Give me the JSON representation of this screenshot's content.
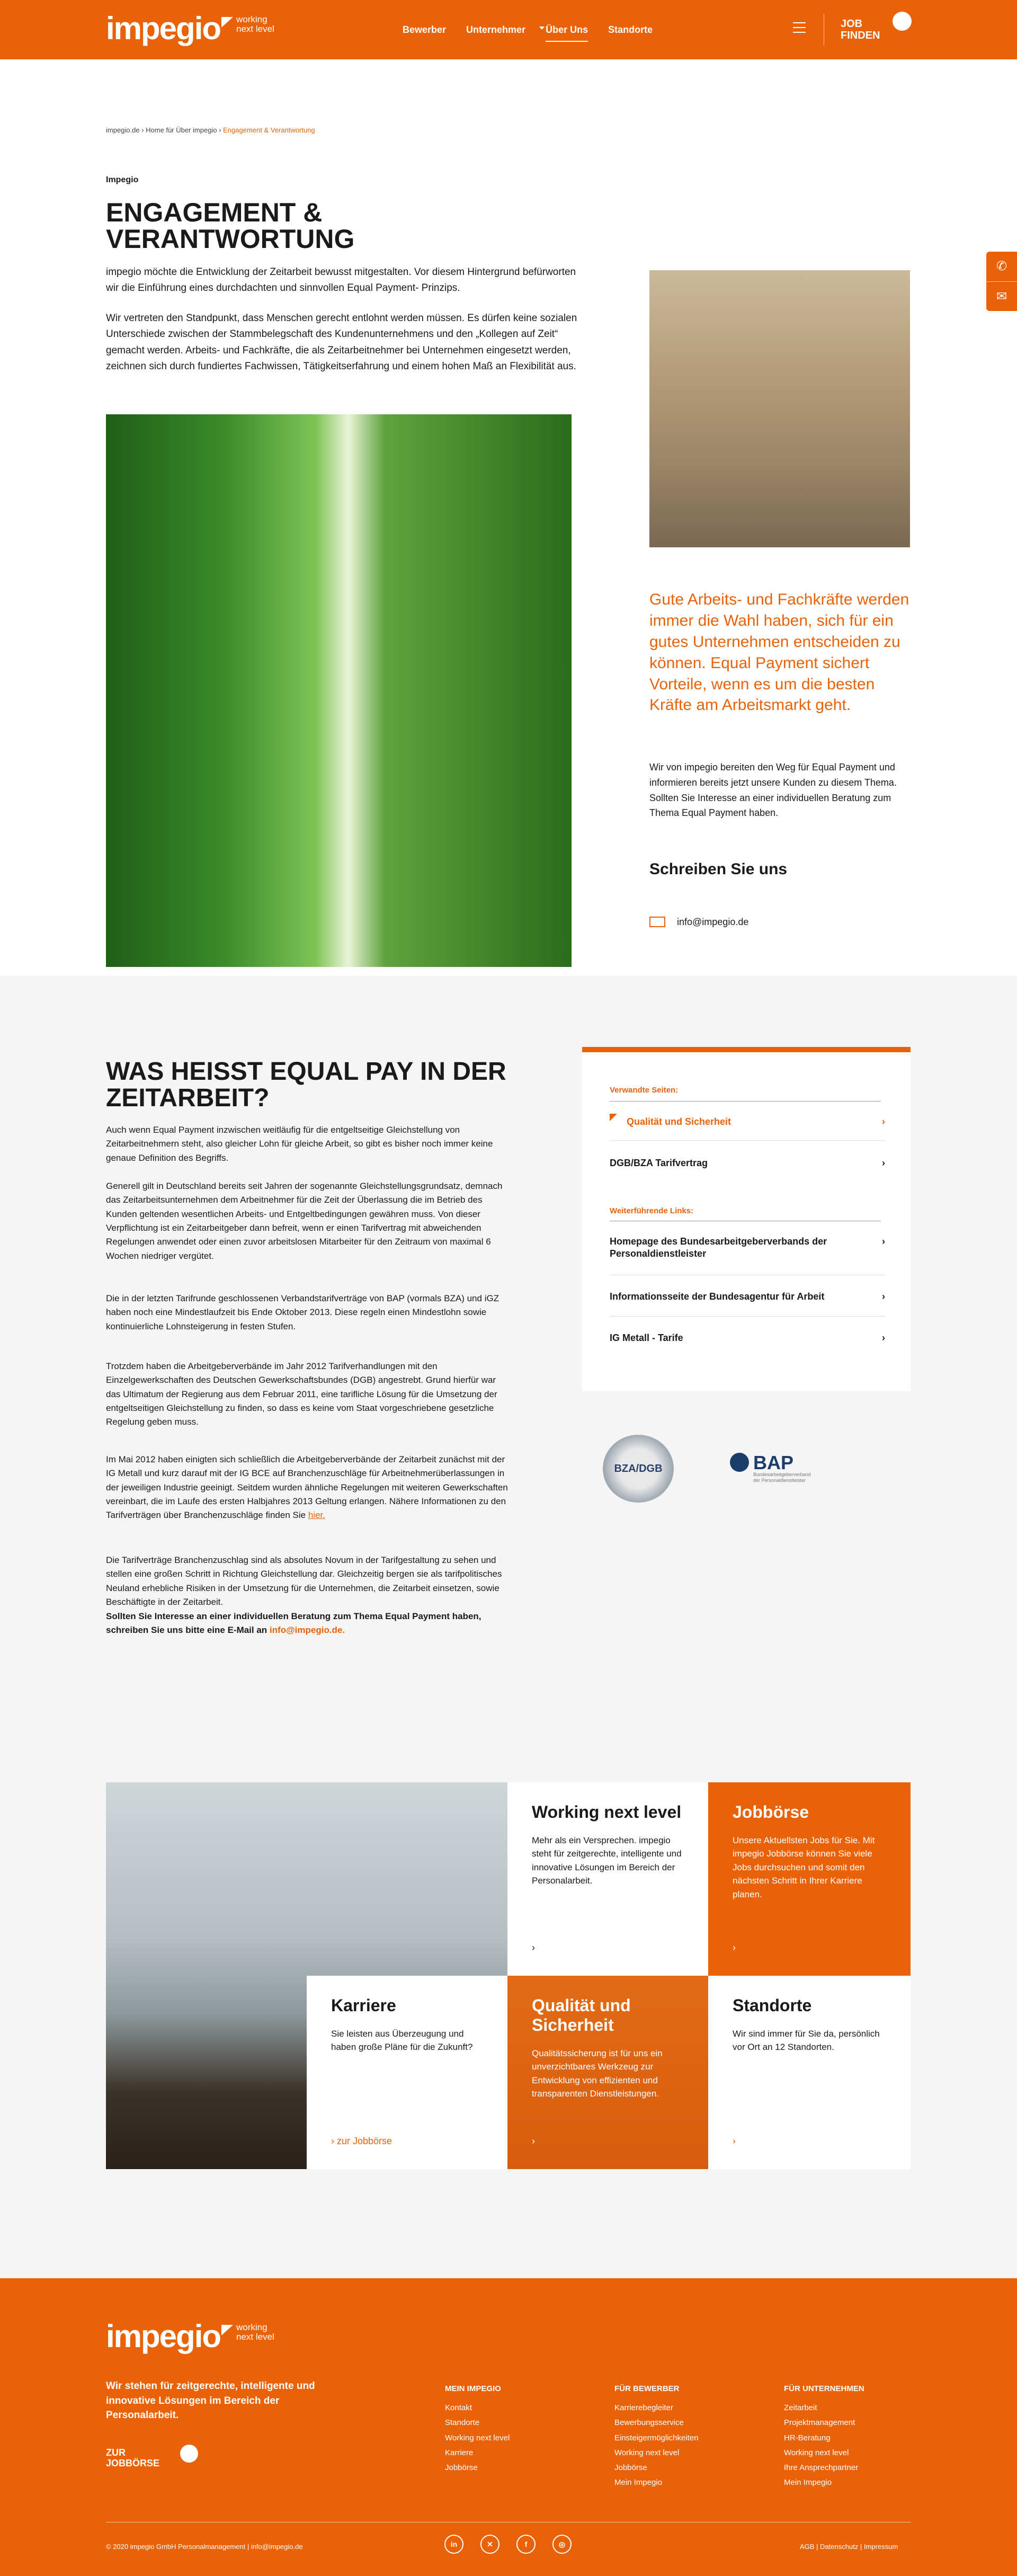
{
  "header": {
    "logo": "impegio",
    "tagline": [
      "working",
      "next level"
    ],
    "nav": [
      "Bewerber",
      "Unternehmer",
      "Über Uns",
      "Standorte"
    ],
    "job_finden": [
      "JOB",
      "FINDEN"
    ]
  },
  "breadcrumb": [
    "impegio.de",
    "Home für Über impegio",
    "Engagement & Verantwortung"
  ],
  "intro": {
    "label": "Impegio",
    "title": "ENGAGEMENT & VERANTWORTUNG",
    "p1": "impegio möchte die Entwicklung der Zeitarbeit bewusst mitgestalten. Vor diesem Hintergrund befürworten wir die Einführung eines durchdachten und sinnvollen Equal Payment- Prinzips.",
    "p2": "Wir vertreten den Standpunkt, dass Menschen gerecht entlohnt werden müssen. Es dürfen keine sozialen Unterschiede zwischen der Stammbelegschaft des Kundenunternehmens und den „Kollegen auf Zeit“ gemacht werden. Arbeits- und Fachkräfte, die als Zeitarbeitnehmer bei Unternehmen eingesetzt werden, zeichnen sich durch fundiertes Fachwissen, Tätigkeitserfahrung und einem hohen Maß an Flexibilität aus.",
    "quote": "Gute Arbeits- und Fachkräfte werden immer die Wahl haben, sich für ein gutes Unternehmen entscheiden zu können. Equal Payment sichert Vorteile, wenn es um die besten Kräfte am Arbeitsmarkt geht.",
    "qp": "Wir von impegio bereiten den Weg für Equal Payment und informieren bereits jetzt unsere Kunden zu diesem Thema. Sollten Sie Interesse an einer individuellen Beratung zum Thema Equal Payment haben.",
    "write_title": "Schreiben Sie uns",
    "email": "info@impegio.de"
  },
  "equal": {
    "title": "WAS HEIßT EQUAL PAY IN DER ZEITARBEIT?",
    "paras": [
      "Auch wenn Equal Payment inzwischen weitläufig für die entgeltseitige Gleichstellung von Zeitarbeitnehmern steht, also gleicher Lohn für gleiche Arbeit, so gibt es bisher noch immer keine genaue Definition des Begriffs.",
      "Generell gilt in Deutschland bereits seit Jahren der sogenannte Gleichstellungsgrundsatz, demnach das Zeitarbeitsunternehmen dem Arbeitnehmer für die Zeit der Überlassung die im Betrieb des Kunden geltenden wesentlichen Arbeits- und Entgeltbedingungen gewähren muss. Von dieser Verpflichtung ist ein Zeitarbeitgeber dann befreit, wenn er einen Tarifvertrag mit abweichenden Regelungen anwendet oder einen zuvor arbeitslosen Mitarbeiter für den Zeitraum von maximal 6 Wochen niedriger vergütet.",
      "Die in der letzten Tarifrunde geschlossenen Verbandstarifverträge von BAP (vormals BZA) und iGZ haben noch eine Mindestlaufzeit bis Ende Oktober 2013. Diese regeln einen Mindestlohn sowie kontinuierliche Lohnsteigerung in festen Stufen.",
      "Trotzdem haben die Arbeitgeberverbände im Jahr 2012 Tarifverhandlungen mit den Einzelgewerkschaften des Deutschen Gewerkschaftsbundes (DGB) angestrebt. Grund hierfür war das Ultimatum der Regierung aus dem Februar 2011, eine tarifliche Lösung für die Umsetzung der entgeltseitigen Gleichstellung zu finden, so dass es keine vom Staat vorgeschriebene gesetzliche Regelung geben muss.",
      "Im Mai 2012 haben einigten sich schließlich die Arbeitgeberverbände der Zeitarbeit zunächst mit der IG Metall und kurz darauf mit der IG BCE auf Branchenzuschläge für Arbeitnehmerüberlassungen in der jeweiligen Industrie geeinigt. Seitdem wurden ähnliche Regelungen mit weiteren Gewerkschaften vereinbart, die im Laufe des ersten Halbjahres 2013 Geltung erlangen.  Nähere Informationen zu den Tarifverträgen über Branchenzuschläge finden Sie",
      "Die Tarifverträge Branchenzuschlag sind als absolutes Novum in der Tarifgestaltung zu sehen und stellen eine großen Schritt in Richtung Gleichstellung dar. Gleichzeitig bergen sie als tarifpolitisches Neuland erhebliche Risiken in der Umsetzung für die Unternehmen, die Zeitarbeit einsetzen, sowie Beschäftigte in der Zeitarbeit."
    ],
    "link_hier": "hier.",
    "cta": "Sollten Sie Interesse an einer individuellen Beratung zum Thema Equal Payment haben, schreiben Sie uns bitte eine E-Mail an",
    "cta_mail": "info@impegio.de."
  },
  "links": {
    "g1": "Verwandte Seiten:",
    "items1": [
      "Qualität und Sicherheit",
      "DGB/BZA Tarifvertrag"
    ],
    "g2": "Weiterführende Links:",
    "items2": [
      "Homepage des Bundesarbeitgeberverbands der Personaldienstleister",
      "Informationsseite der Bundesagentur für Arbeit",
      "IG Metall - Tarife"
    ],
    "bza": "BZA/DGB",
    "bap": "BAP",
    "bap_sub": "Bundesarbeitgeberverband der Personaldienstleister"
  },
  "tiles": [
    {
      "title": "Working next level",
      "text": "Mehr als ein Versprechen. impegio steht für zeitgerechte, intelligente und innovative Lösungen im Bereich der Personalarbeit.",
      "link": "›"
    },
    {
      "title": "Jobbörse",
      "text": "Unsere Aktuellsten Jobs für Sie. Mit impegio Jobbörse können Sie viele Jobs durchsuchen und somit den nächsten Schritt in Ihrer Karriere planen.",
      "link": "›"
    },
    {
      "title": "Karriere",
      "text": "Sie leisten aus Überzeugung und haben große Pläne für die Zukunft?",
      "link": "›  zur Jobbörse"
    },
    {
      "title": "Qualität und Sicherheit",
      "text": "Qualitätssicherung ist  für uns ein unverzichtbares Werkzeug zur Entwicklung von effizienten und transparenten Dienstleistungen.",
      "link": "›"
    },
    {
      "title": "Standorte",
      "text": "Wir sind immer für Sie da, persönlich vor Ort an 12 Standorten.",
      "link": "›"
    }
  ],
  "footer": {
    "claim": "Wir stehen für zeitgerechte, intelligente und innovative Lösungen im Bereich der Personalarbeit.",
    "job": [
      "ZUR",
      "JOBBÖRSE"
    ],
    "cols": [
      {
        "h": "MEIN IMPEGIO",
        "items": [
          "Kontakt",
          "Standorte",
          "Working next level",
          "Karriere",
          "Jobbörse"
        ]
      },
      {
        "h": "FÜR BEWERBER",
        "items": [
          "Karrierebegleiter",
          "Bewerbungsservice",
          "Einsteigermöglichkeiten",
          "Working next level",
          "Jobbörse",
          "Mein Impegio"
        ]
      },
      {
        "h": "FÜR UNTERNEHMEN",
        "items": [
          "Zeitarbeit",
          "Projektmanagement",
          "HR-Beratung",
          "Working next level",
          "Ihre Ansprechpartner",
          "Mein Impegio"
        ]
      }
    ],
    "copy": "© 2020 impegio GmbH Personalmanagement  |  info@impegio.de",
    "social": [
      "in",
      "✕",
      "f",
      "◎"
    ],
    "legal": "AGB  |  Datenschutz  |  Impressum"
  }
}
